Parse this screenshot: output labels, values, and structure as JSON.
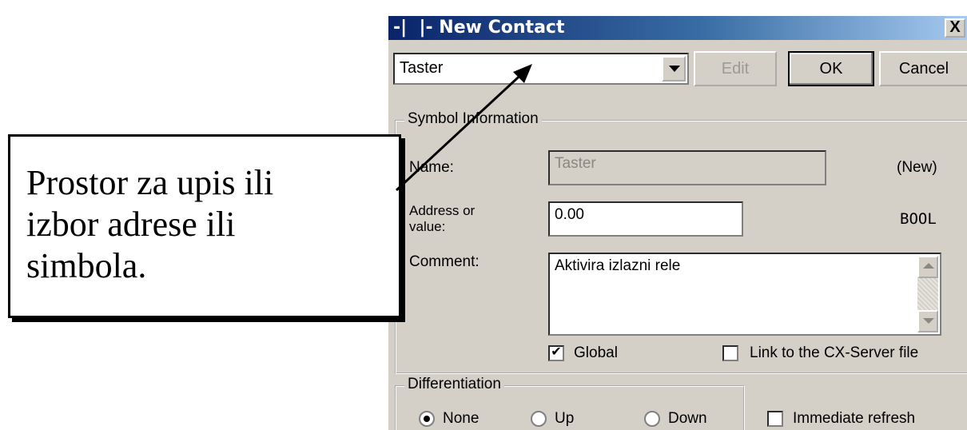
{
  "dialog": {
    "title": "-|  |- New Contact",
    "close_label": "X",
    "symbol_combo_value": "Taster",
    "buttons": {
      "edit": "Edit",
      "ok": "OK",
      "cancel": "Cancel"
    },
    "symbol_group": {
      "legend": "Symbol Information",
      "name_label": "Name:",
      "name_value": "Taster",
      "name_status": "(New)",
      "address_label_line1": "Address or",
      "address_label_line2": "value:",
      "address_value": "0.00",
      "data_type": "BOOL",
      "comment_label": "Comment:",
      "comment_value": "Aktivira izlazni rele",
      "global_label": "Global",
      "global_checked": true,
      "link_label": "Link to the CX-Server file",
      "link_checked": false
    },
    "differentiation_group": {
      "legend": "Differentiation",
      "options": [
        "None",
        "Up",
        "Down"
      ],
      "selected": "None"
    },
    "immediate_refresh_label": "Immediate refresh",
    "immediate_refresh_checked": false
  },
  "callout": {
    "lines": [
      "Prostor za upis ili",
      "izbor adrese ili",
      "simbola."
    ]
  }
}
